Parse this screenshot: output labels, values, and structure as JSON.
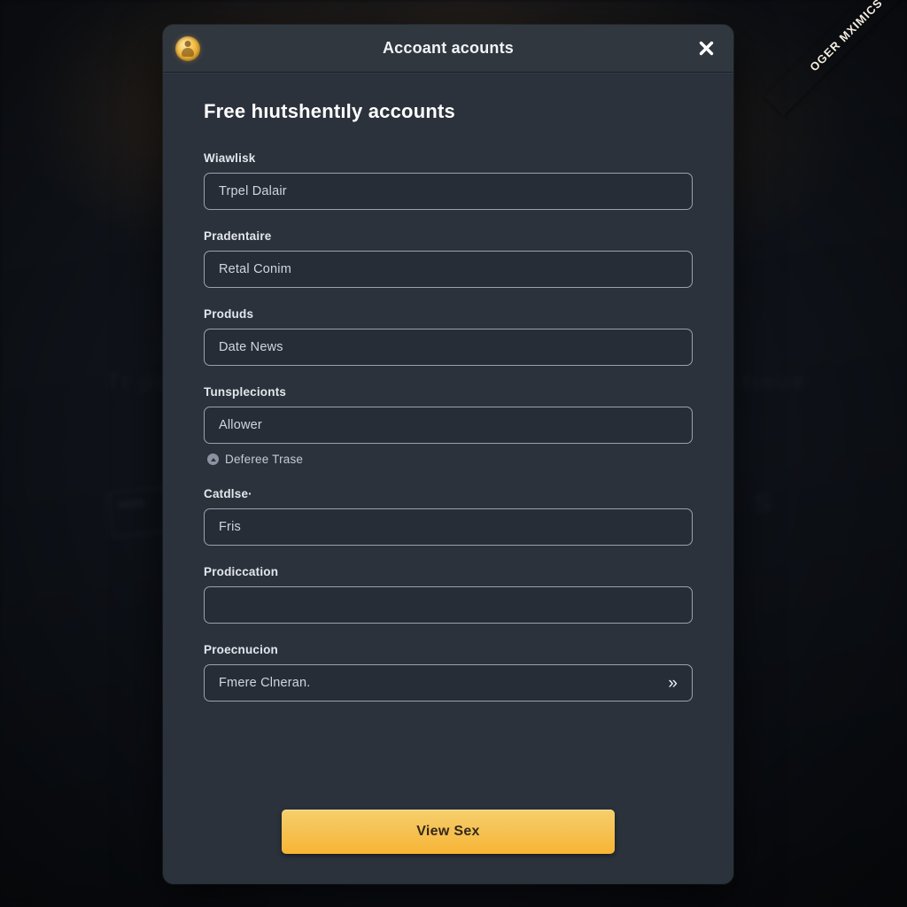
{
  "backdrop": {
    "ghost_left": "Tr po",
    "ghost_right": "tinue",
    "ghost_brand": "A S"
  },
  "ribbon": {
    "label": "OGER MXIMICS",
    "color": "#a78b6a"
  },
  "titlebar": {
    "title": "Accoant acounts",
    "avatar_icon": "user-avatar-icon",
    "close_icon": "close-icon"
  },
  "dialog": {
    "heading": "Free hıutshentıly accounts",
    "panel_color": "#2b323c",
    "titlebar_color": "#30373f",
    "input_border_color": "#99a2ad"
  },
  "fields": [
    {
      "label": "Wiawlisk",
      "value": "Trpel Dalair",
      "chevron": false,
      "empty": false
    },
    {
      "label": "Pradentaire",
      "value": "Retal Conim",
      "chevron": false,
      "empty": false
    },
    {
      "label": "Produds",
      "value": "Date News",
      "chevron": false,
      "empty": false
    },
    {
      "label": "Tunsplecionts",
      "value": "Allower",
      "chevron": false,
      "empty": false
    },
    {
      "label": "Catdlse·",
      "value": "Fris",
      "chevron": false,
      "empty": false
    },
    {
      "label": "Prodiccation",
      "value": "",
      "chevron": false,
      "empty": true
    },
    {
      "label": "Proecnucion",
      "value": "Fmere Clneran.",
      "chevron": true,
      "empty": false
    }
  ],
  "helper": {
    "icon": "circle-up-arrow-icon",
    "text": "Deferee Trase"
  },
  "footer": {
    "primary_label": "View Sex",
    "primary_color": "#f5c357"
  },
  "icons": {
    "chevron_double_right": "»"
  }
}
